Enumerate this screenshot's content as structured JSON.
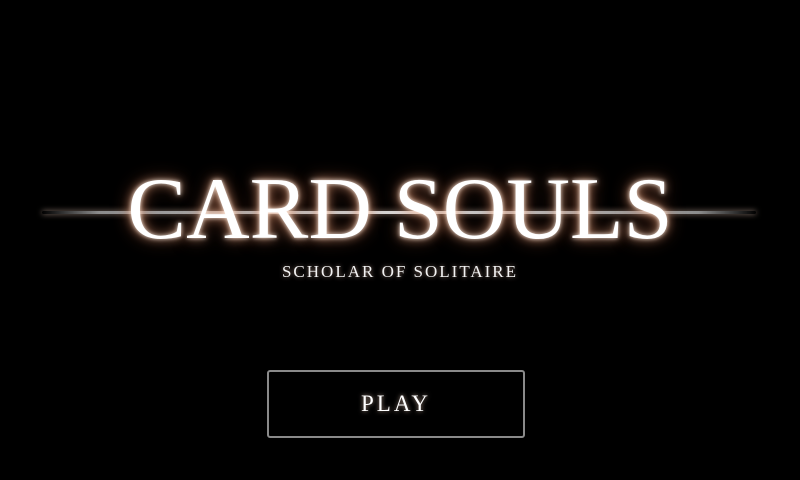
{
  "game": {
    "title": "CARD SOULS",
    "subtitle": "SCHOLAR OF SOLITAIRE"
  },
  "menu": {
    "play_label": "PLAY"
  },
  "colors": {
    "background": "#000000",
    "text": "#ffffff",
    "glow": "#dc6e46",
    "button_border": "#8a8a8a"
  }
}
